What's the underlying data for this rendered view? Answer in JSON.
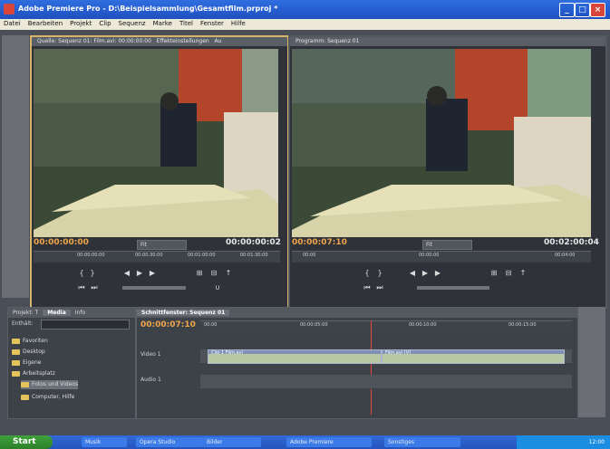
{
  "window": {
    "title": "Adobe Premiere Pro - D:\\Beispielsammlung\\Gesamtfilm.prproj *",
    "controls": [
      "_",
      "□",
      "×"
    ]
  },
  "menu": [
    "Datei",
    "Bearbeiten",
    "Projekt",
    "Clip",
    "Sequenz",
    "Marke",
    "Titel",
    "Fenster",
    "Hilfe"
  ],
  "source_monitor": {
    "tab_label": "Quelle: Sequenz 01: Film.avi: 00:00:00:00",
    "tab_label_2": "Effekteinstellungen",
    "tab_label_3": "Au",
    "timecode_left": "00:00:00:00",
    "timecode_right": "00:00:00:02",
    "fit_label": "Fit",
    "ruler": [
      "00:00:00:00",
      "00:00:30:00",
      "00:01:00:00",
      "00:01:30:00"
    ]
  },
  "program_monitor": {
    "tab_label": "Programm: Sequenz 01",
    "timecode_left": "00:00:07:10",
    "timecode_right": "00:02:00:04",
    "fit_label": "Fit",
    "ruler": [
      "00:00",
      "00:00:00",
      "00:04:00"
    ]
  },
  "project_panel": {
    "tabs": [
      "Projekt: T",
      "Media",
      "Info"
    ],
    "search_label": "Enthält:",
    "items": [
      "Favoriten",
      "Desktop",
      "Eigene",
      "Arbeitsplatz",
      "Fotos und Videos",
      "Computer, Hilfe"
    ]
  },
  "timeline": {
    "tab_label": "Schnittfenster: Sequenz 01",
    "timecode": "00:00:07:10",
    "ruler": [
      "00:00",
      "00:00:05:00",
      "00:00:10:00",
      "00:00:15:00"
    ],
    "video_track": "Video 1",
    "audio_track": "Audio 1",
    "clip_label": "Clip 1 Film.avi",
    "clip_label_2": "Film.avi [V]"
  },
  "taskbar": {
    "start": "Start",
    "tasks": [
      "Musik",
      "Opera Studio",
      "Bilder",
      "Adobe Premiere",
      "Sonstiges"
    ],
    "clock": "12:00"
  },
  "colors": {
    "accent_timecode": "#f0a64a",
    "selected_border": "#d6b46a",
    "titlebar": "#2f6fe0"
  }
}
